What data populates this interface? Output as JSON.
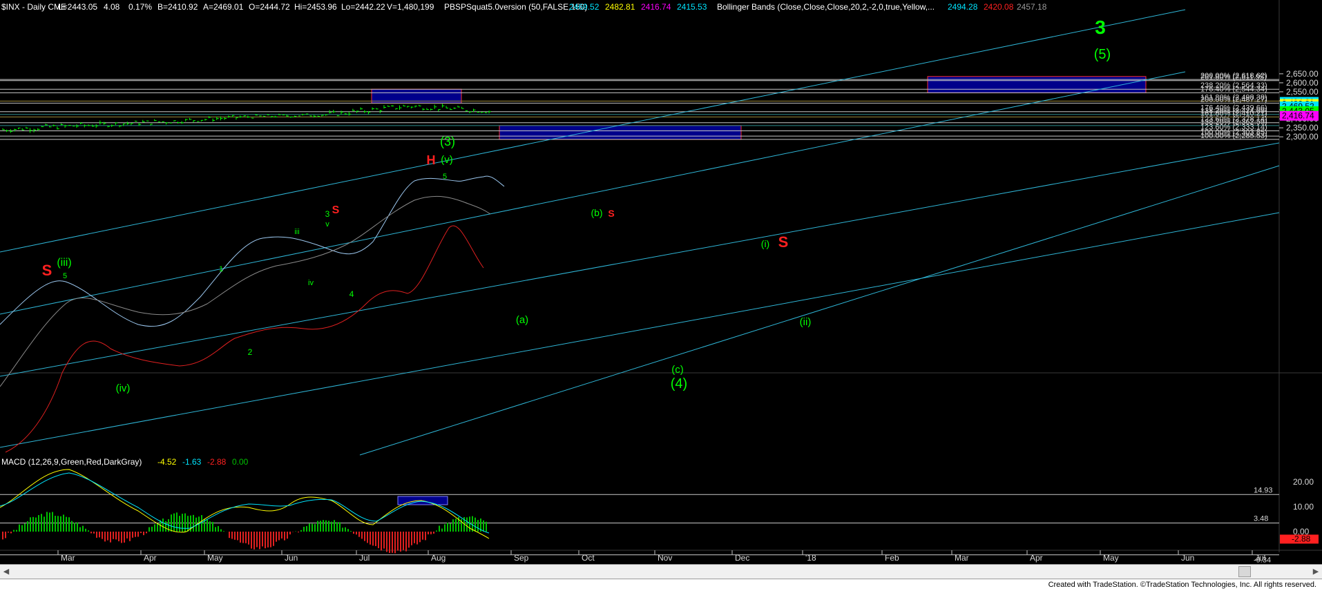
{
  "header": {
    "items": [
      {
        "text": "$INX - Daily  CME",
        "color": "#ffffff"
      },
      {
        "text": "L=2443.05",
        "color": "#ffffff"
      },
      {
        "text": "4.08",
        "color": "#ffffff"
      },
      {
        "text": "0.17%",
        "color": "#ffffff"
      },
      {
        "text": "B=2410.92",
        "color": "#ffffff"
      },
      {
        "text": "A=2469.01",
        "color": "#ffffff"
      },
      {
        "text": "O=2444.72",
        "color": "#ffffff"
      },
      {
        "text": "Hi=2453.96",
        "color": "#ffffff"
      },
      {
        "text": "Lo=2442.22",
        "color": "#ffffff"
      },
      {
        "text": "V=1,480,199",
        "color": "#ffffff"
      },
      {
        "text": "PBSPSquat5.0version (50,FALSE,150)",
        "color": "#ffffff"
      },
      {
        "text": "2469.52",
        "color": "#00e5ff"
      },
      {
        "text": "2482.81",
        "color": "#ffff00"
      },
      {
        "text": "2416.74",
        "color": "#ff00ff"
      },
      {
        "text": "2415.53",
        "color": "#00e5ff"
      },
      {
        "text": "Bollinger Bands (Close,Close,Close,20,2,-2,0,true,Yellow,...",
        "color": "#ffffff"
      },
      {
        "text": "2494.28",
        "color": "#00e5ff"
      },
      {
        "text": "2420.08",
        "color": "#ff2020"
      },
      {
        "text": "2457.18",
        "color": "#9a9a9a"
      }
    ]
  },
  "macd_header": {
    "items": [
      {
        "text": "MACD (12,26,9,Green,Red,DarkGray)",
        "color": "#ffffff"
      },
      {
        "text": "-4.52",
        "color": "#ffff00"
      },
      {
        "text": "-1.63",
        "color": "#00e5ff"
      },
      {
        "text": "-2.88",
        "color": "#ff2020"
      },
      {
        "text": "0.00",
        "color": "#00c000"
      }
    ]
  },
  "chart_data": {
    "type": "candlestick",
    "price_axis": {
      "ylim": [
        2255,
        2655
      ],
      "ticks": [
        "2,300.00",
        "2,350.00",
        "2,400.00",
        "2,450.00",
        "2,500.00",
        "2,550.00",
        "2,600.00",
        "2,650.00"
      ]
    },
    "x_labels": [
      "Mar",
      "Apr",
      "May",
      "Jun",
      "Jul",
      "Aug",
      "Sep",
      "Oct",
      "Nov",
      "Dec",
      "'18",
      "Feb",
      "Mar",
      "Apr",
      "May",
      "Jun",
      "Jul"
    ],
    "ohlc_monthly": [
      {
        "month": "Mar",
        "open": 2340,
        "high": 2401,
        "low": 2322,
        "close": 2363
      },
      {
        "month": "Apr",
        "open": 2363,
        "high": 2398,
        "low": 2328,
        "close": 2384
      },
      {
        "month": "May",
        "open": 2384,
        "high": 2418,
        "low": 2352,
        "close": 2411
      },
      {
        "month": "Jun",
        "open": 2411,
        "high": 2454,
        "low": 2405,
        "close": 2423
      },
      {
        "month": "Jul",
        "open": 2424,
        "high": 2484,
        "low": 2407,
        "close": 2470
      },
      {
        "month": "Aug",
        "open": 2470,
        "high": 2490,
        "low": 2417,
        "close": 2443
      }
    ],
    "levels": [
      {
        "label": "200.00% (2,618.62)",
        "value": 2618.62,
        "color": "#c8c8c8"
      },
      {
        "label": "261.80% (2,611.95)",
        "value": 2611.95,
        "color": "#c8c8c8"
      },
      {
        "label": "238.20% (2,564.33)",
        "value": 2564.33,
        "color": "#c8c8c8"
      },
      {
        "label": "176.40% (2,544.34)",
        "value": 2544.34,
        "color": "#c8c8c8"
      },
      {
        "label": "161.80% (2,498.38)",
        "value": 2498.38,
        "color": "#a08c3c"
      },
      {
        "label": "200.00% (2,487.27)",
        "value": 2487.27,
        "color": "#c8c8c8"
      },
      {
        "label": "176.40% (2,439.66)",
        "value": 2439.66,
        "color": "#c8c8c8"
      },
      {
        "label": "138.20% (2,424.09)",
        "value": 2424.09,
        "color": "#2e8b8b"
      },
      {
        "label": "161.80% (2,410.21)",
        "value": 2410.21,
        "color": "#a08c3c"
      },
      {
        "label": "123.60% (2,378.14)",
        "value": 2378.14,
        "color": "#c8c8c8"
      },
      {
        "label": "138.20% (2,362.59)",
        "value": 2362.59,
        "color": "#2e8b8b"
      },
      {
        "label": "123.60% (2,333.14)",
        "value": 2333.14,
        "color": "#c8c8c8"
      },
      {
        "label": "100.00% (2,303.85)",
        "value": 2303.85,
        "color": "#c8c8c8"
      },
      {
        "label": "100.00% (2,285.53)",
        "value": 2285.53,
        "color": "#c8c8c8"
      }
    ],
    "price_tags": [
      {
        "text": "2,494.28",
        "value": 2494.28,
        "bg": "#00e5ff",
        "fg": "#000000"
      },
      {
        "text": "2,482.81",
        "value": 2482.81,
        "bg": "#ffff00",
        "fg": "#000000"
      },
      {
        "text": "2,469.52",
        "value": 2469.52,
        "bg": "#00e5ff",
        "fg": "#000000"
      },
      {
        "text": "2,443.05",
        "value": 2443.05,
        "bg": "#00ff00",
        "fg": "#000000"
      },
      {
        "text": "2,416.74",
        "value": 2416.74,
        "bg": "#ff00ff",
        "fg": "#000000"
      }
    ],
    "target_boxes": [
      {
        "x_start": "Jul",
        "x_end": "Aug",
        "low": 2487.27,
        "high": 2564.33
      },
      {
        "x_start": "Feb",
        "x_end": "May",
        "low": 2544.34,
        "high": 2635
      },
      {
        "x_start": "Sep",
        "x_end": "Dec",
        "low": 2285.53,
        "high": 2362.59
      }
    ],
    "wave_labels": [
      {
        "text": "S",
        "color": "#ff2020"
      },
      {
        "text": "(iii)",
        "color": "#00ff00"
      },
      {
        "text": "5",
        "color": "#00ff00"
      },
      {
        "text": "(iv)",
        "color": "#00ff00"
      },
      {
        "text": "iii",
        "color": "#00ff00"
      },
      {
        "text": "1",
        "color": "#00ff00"
      },
      {
        "text": "2",
        "color": "#00ff00"
      },
      {
        "text": "3",
        "color": "#00ff00"
      },
      {
        "text": "v",
        "color": "#00ff00"
      },
      {
        "text": "S",
        "color": "#ff2020"
      },
      {
        "text": "iv",
        "color": "#00ff00"
      },
      {
        "text": "4",
        "color": "#00ff00"
      },
      {
        "text": "(3)",
        "color": "#00ff00"
      },
      {
        "text": "H",
        "color": "#ff2020"
      },
      {
        "text": "(v)",
        "color": "#00ff00"
      },
      {
        "text": "5",
        "color": "#00ff00"
      },
      {
        "text": "(b)",
        "color": "#00ff00"
      },
      {
        "text": "S",
        "color": "#ff2020"
      },
      {
        "text": "(a)",
        "color": "#00ff00"
      },
      {
        "text": "(c)",
        "color": "#00ff00"
      },
      {
        "text": "(4)",
        "color": "#00ff00"
      },
      {
        "text": "(i)",
        "color": "#00ff00"
      },
      {
        "text": "S",
        "color": "#ff2020"
      },
      {
        "text": "(ii)",
        "color": "#00ff00"
      },
      {
        "text": "3",
        "color": "#00ff00"
      },
      {
        "text": "(5)",
        "color": "#00ff00"
      }
    ],
    "macd": {
      "levels": [
        {
          "label": "14.93",
          "value": 14.93
        },
        {
          "label": "3.48",
          "value": 3.48
        },
        {
          "label": "-9.34",
          "value": -9.34
        }
      ],
      "ticks": [
        "20.00",
        "10.00",
        "0.00"
      ],
      "tag": {
        "text": "-2.88",
        "bg": "#ff2020",
        "fg": "#000000"
      },
      "values": {
        "macd": -4.52,
        "signal": -1.63,
        "histogram": -2.88
      }
    }
  },
  "footer": {
    "text": "Created with TradeStation. ©TradeStation Technologies, Inc. All rights reserved."
  },
  "colors": {
    "background": "#000000",
    "bar": "#00ff00",
    "channel": "#2fb7d8",
    "box_fill": "#00008b",
    "box_border": "#ff3030"
  }
}
